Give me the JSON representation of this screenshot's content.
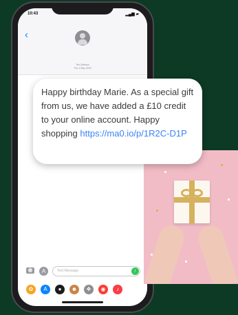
{
  "status_bar": {
    "time": "10:43",
    "icons": "▂▄▆ ▰"
  },
  "conversation": {
    "sender_name": "Ted Gateaux",
    "date_line": "Thu 4 May 2023"
  },
  "message": {
    "text": "Happy birthday Marie. As a special gift from us, we have added a £10 credit to your online account. Happy shopping ",
    "link": "https://ma0.io/p/1R2C-D1P"
  },
  "input": {
    "placeholder": "Text Message"
  },
  "app_tray": [
    {
      "icon": "photos-icon",
      "color": "#f5a623"
    },
    {
      "icon": "app-store-icon",
      "color": "#0a84ff"
    },
    {
      "icon": "apple-pay-icon",
      "color": "#1c1c1e"
    },
    {
      "icon": "memoji-icon",
      "color": "#c8854a"
    },
    {
      "icon": "digital-touch-icon",
      "color": "#8e8e93"
    },
    {
      "icon": "images-search-icon",
      "color": "#ff3b30"
    },
    {
      "icon": "music-icon",
      "color": "#fc3c44"
    }
  ],
  "colors": {
    "background": "#0c3a25",
    "link": "#3b82f6",
    "photo_background": "#f2bcc7",
    "ribbon": "#d6b25e"
  }
}
